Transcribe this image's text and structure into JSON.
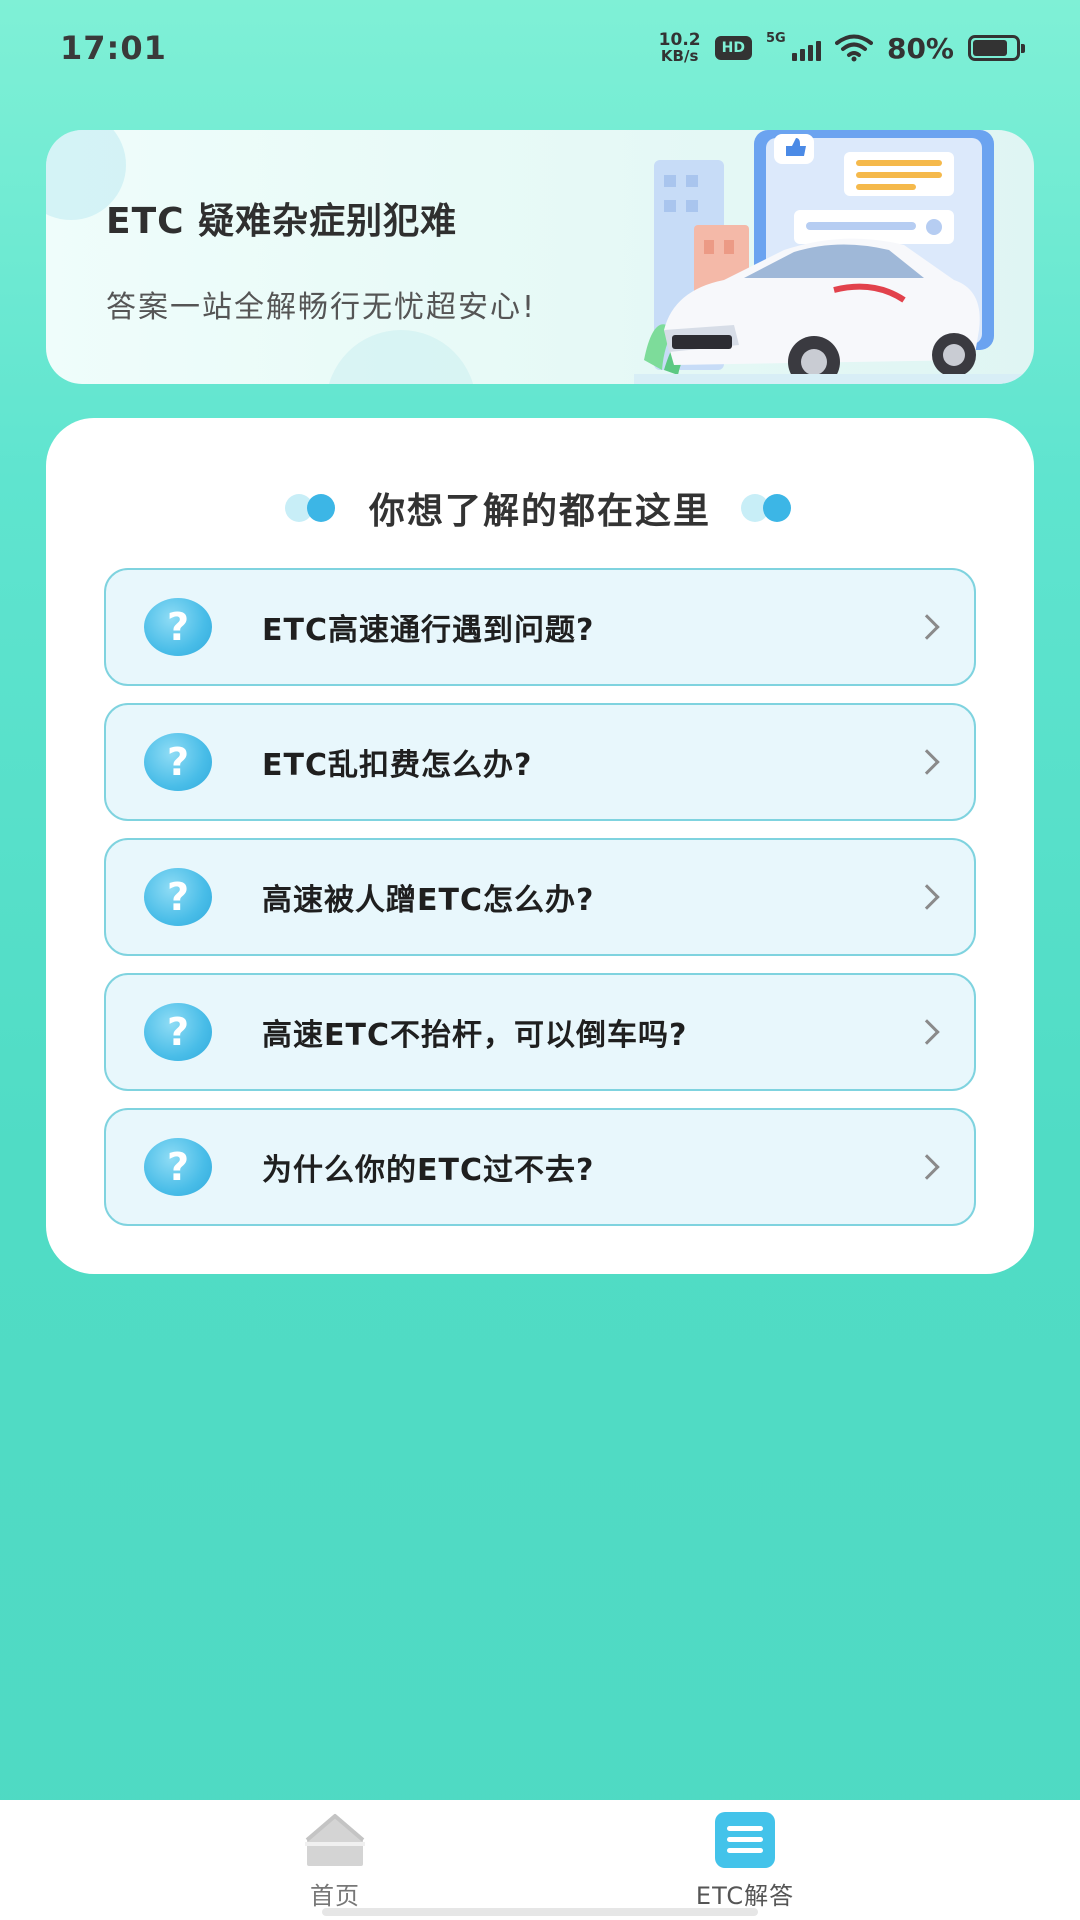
{
  "status_bar": {
    "time": "17:01",
    "net_speed_value": "10.2",
    "net_speed_unit": "KB/s",
    "hd": "HD",
    "network": "5G",
    "battery": "80%"
  },
  "banner": {
    "title": "ETC 疑难杂症别犯难",
    "subtitle": "答案一站全解畅行无忧超安心!"
  },
  "faq": {
    "title": "你想了解的都在这里",
    "items": [
      {
        "label": "ETC高速通行遇到问题?"
      },
      {
        "label": "ETC乱扣费怎么办?"
      },
      {
        "label": "高速被人蹭ETC怎么办?"
      },
      {
        "label": "高速ETC不抬杆，可以倒车吗?"
      },
      {
        "label": "为什么你的ETC过不去?"
      }
    ],
    "icon_glyph": "?"
  },
  "bottom_nav": {
    "items": [
      {
        "label": "首页",
        "icon": "home-icon",
        "active": false
      },
      {
        "label": "ETC解答",
        "icon": "list-icon",
        "active": true
      }
    ]
  },
  "colors": {
    "background": "#50dcc5",
    "accent": "#3cb6e6",
    "item_border": "#7fd3df",
    "item_bg": "#e8f7fc"
  }
}
